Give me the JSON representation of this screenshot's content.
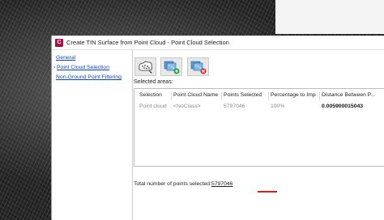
{
  "dialog": {
    "title": "Create TIN Surface from Point Cloud - Point Cloud Selection",
    "icon_letter": "C"
  },
  "nav": {
    "items": [
      {
        "label": "General",
        "active": false
      },
      {
        "label": "Point Cloud Selection",
        "active": true
      },
      {
        "label": "Non-Ground Point Filtering",
        "active": false
      }
    ],
    "active_marker": "›"
  },
  "toolbar": {
    "buttons": [
      {
        "icon": "point-cloud-select-icon"
      },
      {
        "icon": "add-point-cloud-icon"
      },
      {
        "icon": "remove-point-cloud-icon"
      }
    ]
  },
  "selected_areas": {
    "label": "Selected areas:",
    "columns": [
      "Selection",
      "Point Cloud Name",
      "Points Selected",
      "Percentage to Import",
      "Distance Between P..."
    ],
    "rows": [
      [
        "Point cloud",
        "<NoClass>",
        "5797046",
        "100%",
        "0.005900015043"
      ]
    ]
  },
  "total": {
    "label": "Total number of points selected:",
    "value": "5797046"
  },
  "colors": {
    "accent_red": "#e01b1b",
    "link_blue": "#0b45c4",
    "app_icon": "#a3154a"
  }
}
